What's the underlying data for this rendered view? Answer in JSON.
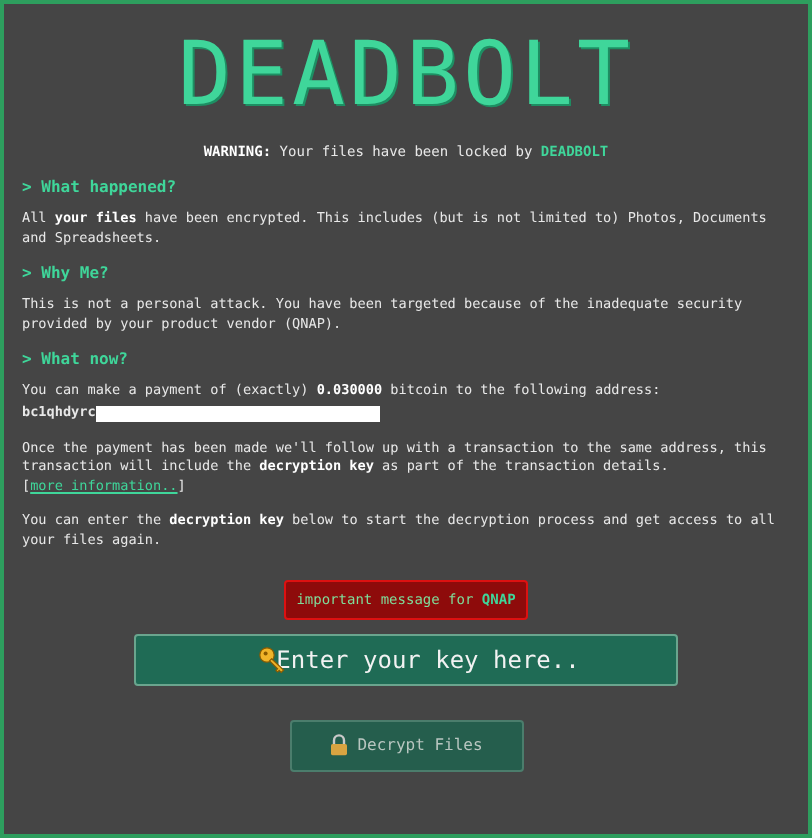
{
  "title": "DEADBOLT",
  "warning": "**WARNING:** Your files have been locked by **DEADBOLT**",
  "sections": [
    {
      "heading": "> What happened?",
      "paragraphs": [
        {
          "text": "All **your files** have been encrypted. This includes (but is not limited to) Photos, Documents and Spreadsheets."
        }
      ]
    },
    {
      "heading": "> Why Me?",
      "paragraphs": [
        {
          "text": "This is not a personal attack. You have been targeted because of the inadequate security provided by your product vendor (QNAP)."
        }
      ]
    },
    {
      "heading": "> What now?",
      "paragraphs": [
        {
          "text": "You can make a payment of (exactly) **0.030000** bitcoin to the following address:",
          "address": "bc1qhdyrc"
        },
        {
          "text": "Once the payment has been made we'll follow up with a transaction to the same address, this transaction will include the **decryption key** as part of the transaction details. [",
          "link": "more information..",
          "after": "]"
        },
        {
          "text": "You can enter the **decryption key** below to start the decryption process and get access to all your files again."
        }
      ]
    }
  ],
  "message_button": "important message for **QNAP**",
  "key_field": {
    "placeholder": "Enter your key here.."
  },
  "decrypt_button": "Decrypt Files"
}
